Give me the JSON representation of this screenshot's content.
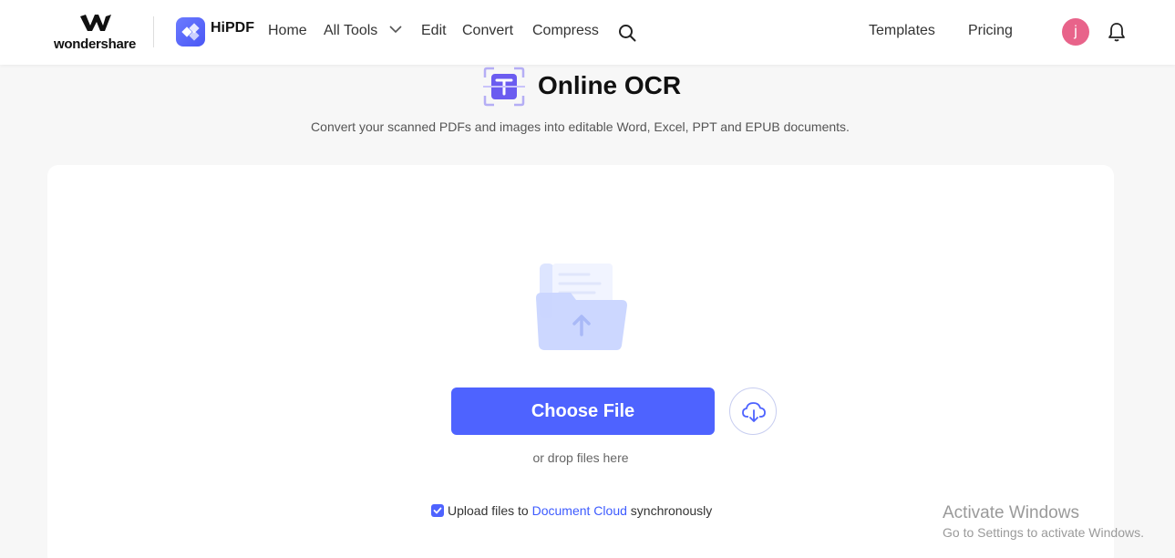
{
  "brand": {
    "company": "wondershare",
    "product": "HiPDF"
  },
  "nav": {
    "home": "Home",
    "all_tools": "All Tools",
    "edit": "Edit",
    "convert": "Convert",
    "compress": "Compress",
    "templates": "Templates",
    "pricing": "Pricing",
    "avatar_initial": "j"
  },
  "page": {
    "title": "Online OCR",
    "subtitle": "Convert your scanned PDFs and images into editable Word, Excel, PPT and EPUB documents."
  },
  "upload": {
    "choose_label": "Choose File",
    "drop_hint": "or drop files here",
    "sync_prefix": "Upload files to ",
    "sync_link": "Document Cloud",
    "sync_suffix": " synchronously",
    "sync_checked": true
  },
  "watermark": {
    "title": "Activate Windows",
    "subtitle": "Go to Settings to activate Windows."
  },
  "colors": {
    "accent": "#4e63ff",
    "avatar": "#e8638a",
    "brand_purple": "#6b5cf0"
  }
}
